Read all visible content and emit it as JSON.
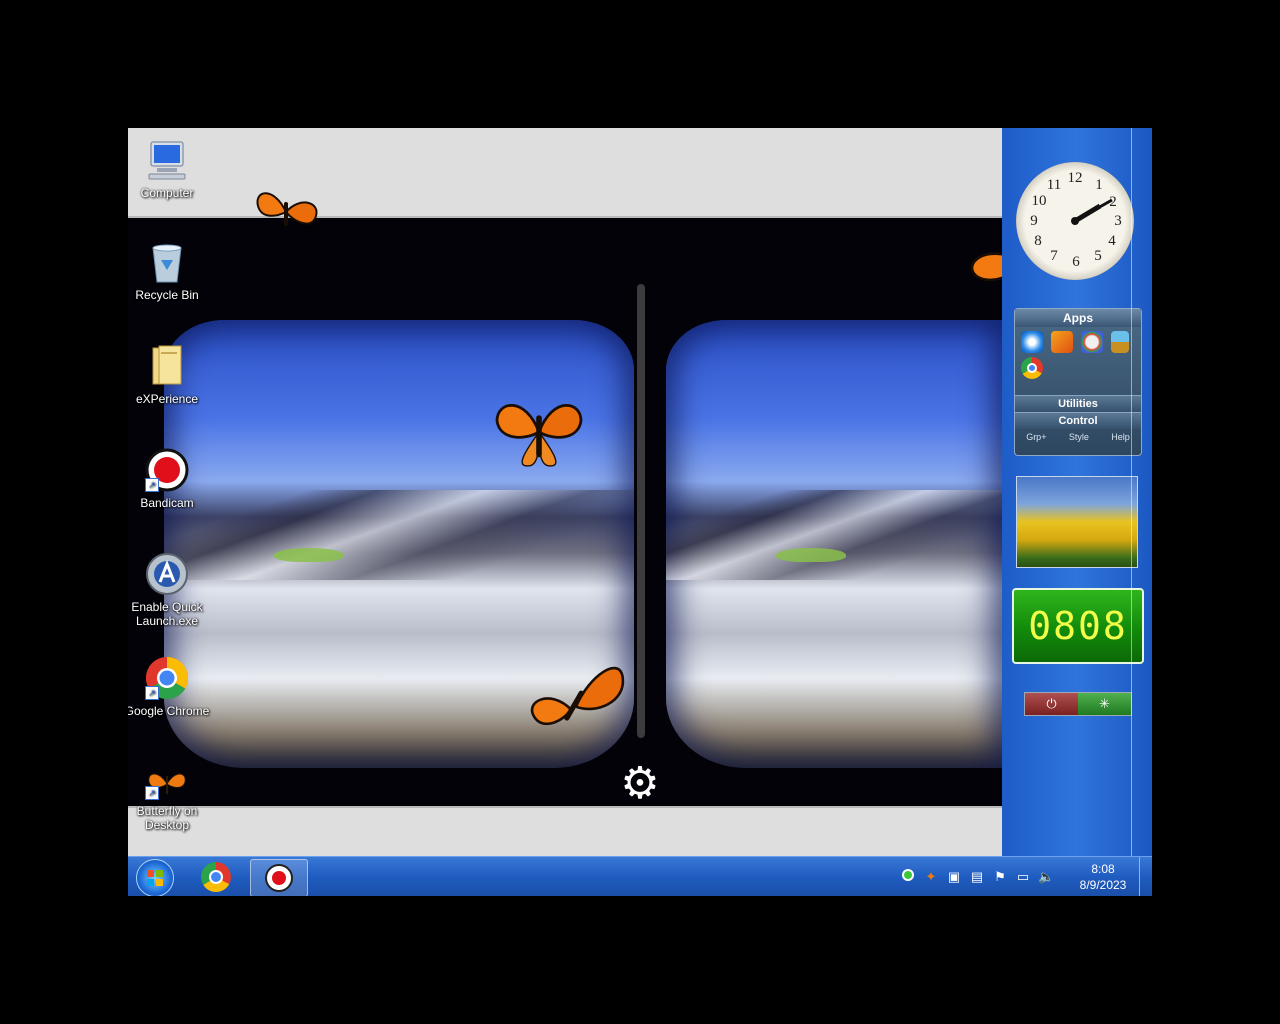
{
  "desktop": {
    "icons": [
      {
        "label": "Computer"
      },
      {
        "label": "Recycle Bin"
      },
      {
        "label": "eXPerience"
      },
      {
        "label": "Bandicam"
      },
      {
        "label": "Enable Quick Launch.exe"
      },
      {
        "label": "Google Chrome"
      },
      {
        "label": "Butterfly on Desktop"
      }
    ]
  },
  "sidebar": {
    "clock_numbers": [
      "12",
      "1",
      "2",
      "3",
      "4",
      "5",
      "6",
      "7",
      "8",
      "9",
      "10",
      "11"
    ],
    "apps_gadget": {
      "title": "Apps",
      "utilities": "Utilities",
      "control": "Control",
      "links": [
        "Grp+",
        "Style",
        "Help"
      ]
    },
    "digital_clock": "0808"
  },
  "taskbar": {
    "time": "8:08",
    "date": "8/9/2023",
    "tray_icons": [
      "status-dot-icon",
      "butterfly-tray-icon",
      "network-box-icon",
      "document-icon",
      "flag-icon",
      "display-icon",
      "volume-icon"
    ]
  },
  "colors": {
    "taskbar": "#1f5cc0",
    "sidebar": "#2f74dc",
    "digital_clock_bg": "#128a0a",
    "digital_clock_digits": "#f2ff4a"
  }
}
